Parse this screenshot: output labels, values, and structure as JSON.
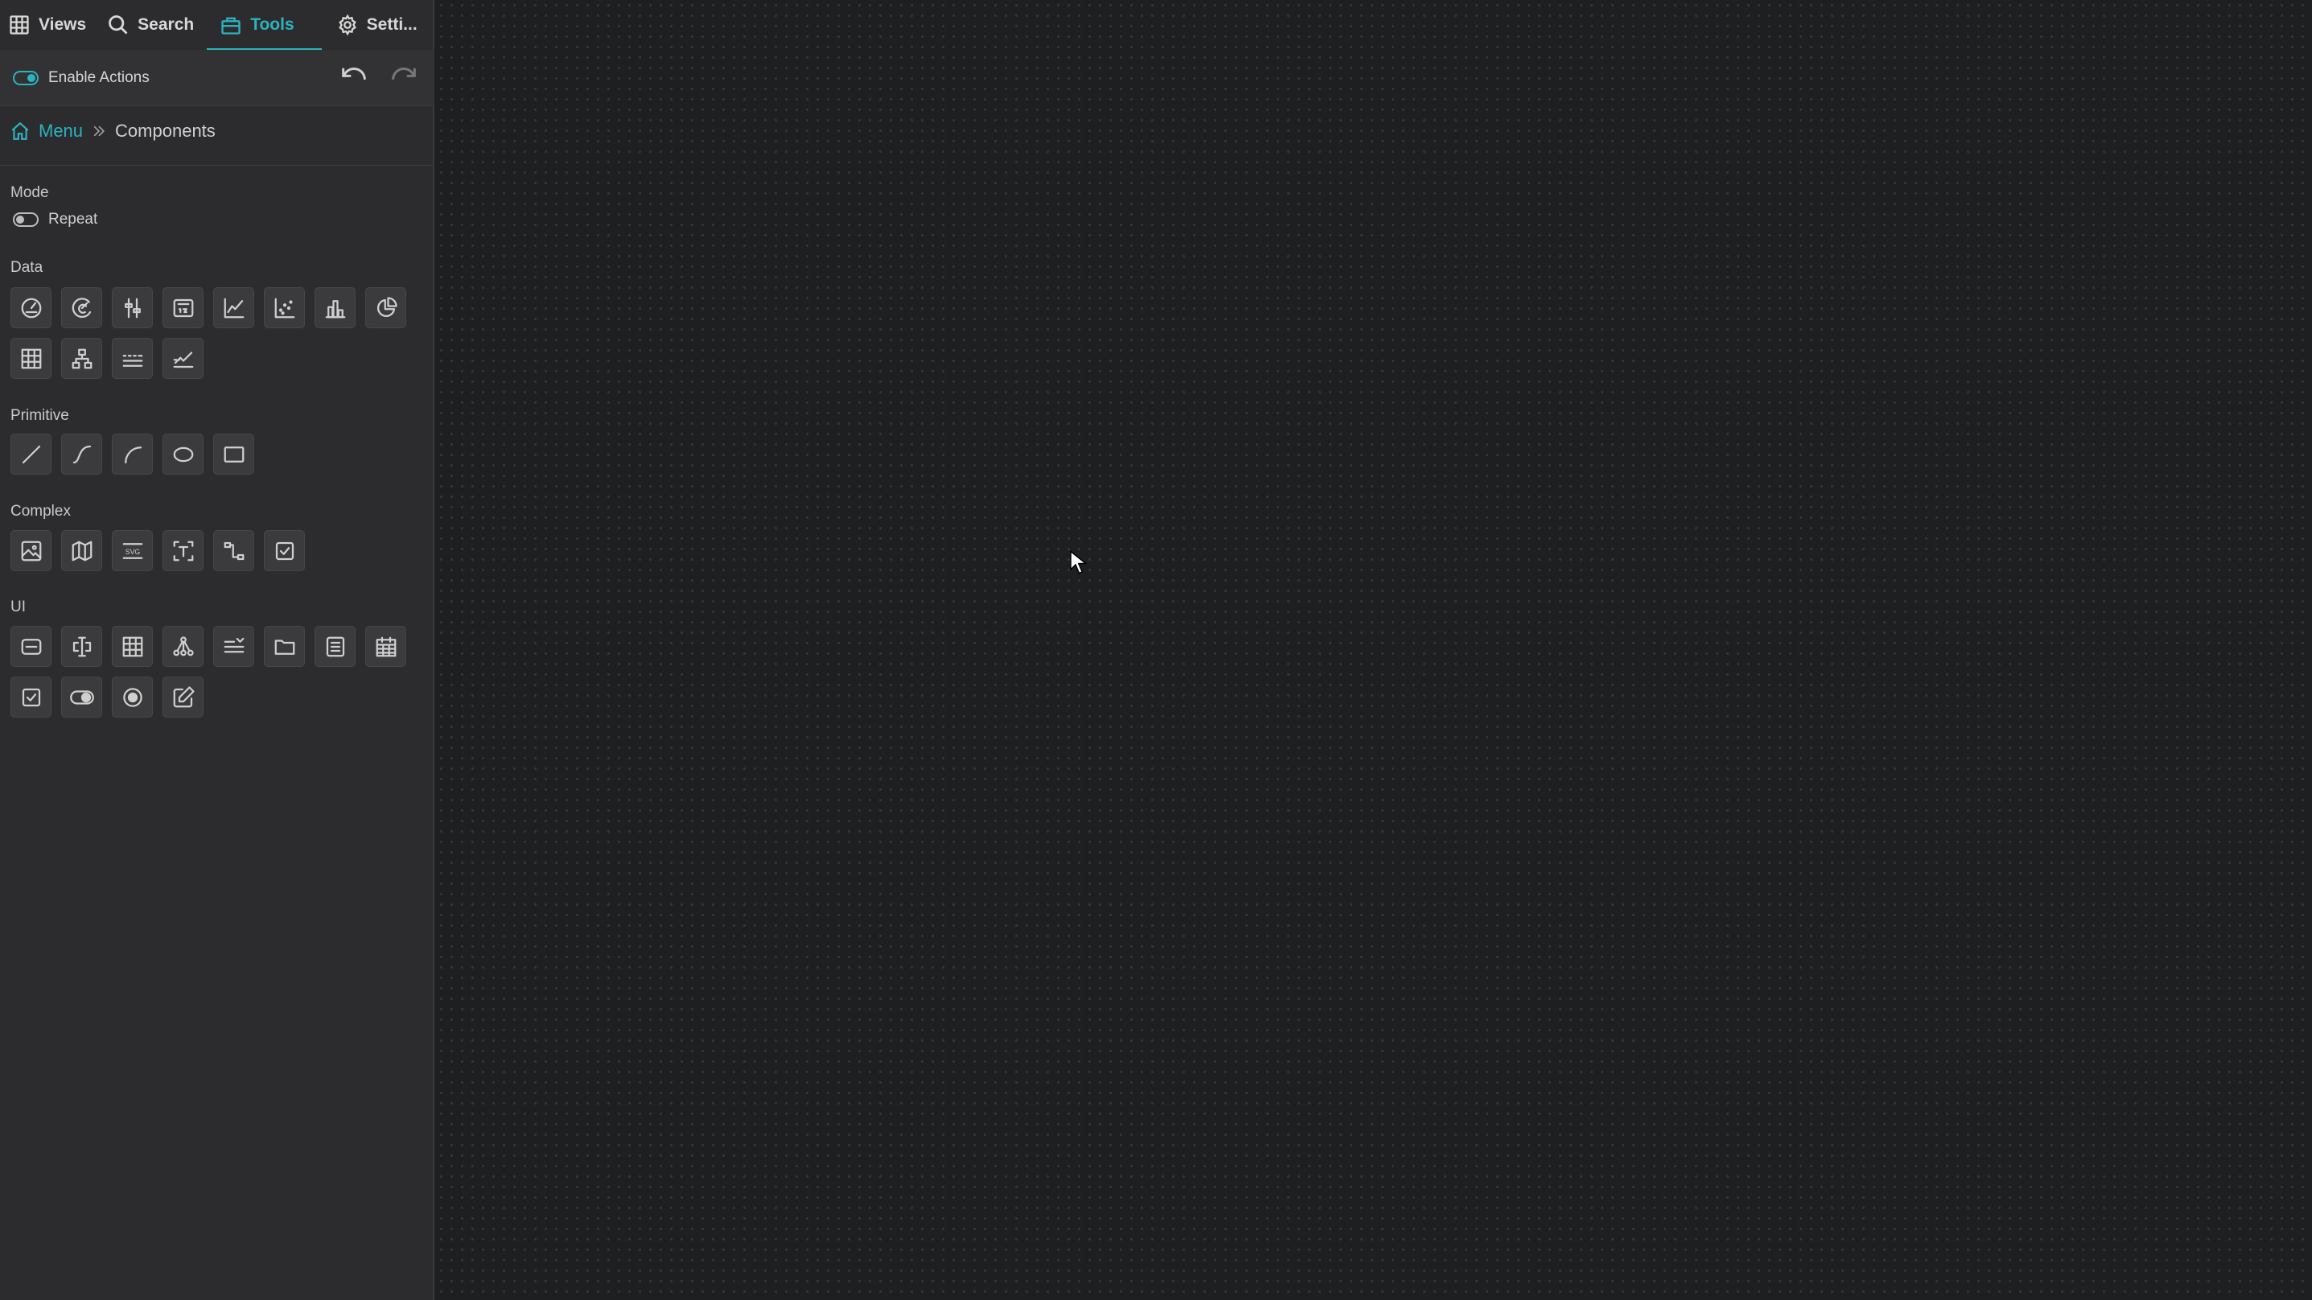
{
  "tabs": [
    {
      "label": "Views",
      "icon": "grid-icon"
    },
    {
      "label": "Search",
      "icon": "search-icon"
    },
    {
      "label": "Tools",
      "icon": "toolbox-icon",
      "active": true
    },
    {
      "label": "Setti...",
      "icon": "gear-icon"
    }
  ],
  "actions": {
    "enable_label": "Enable Actions",
    "enabled": true
  },
  "breadcrumb": {
    "menu": "Menu",
    "current": "Components"
  },
  "sections": {
    "mode": "Mode",
    "mode_option": "Repeat",
    "mode_repeat_on": false,
    "data": "Data",
    "primitive": "Primitive",
    "complex": "Complex",
    "ui": "UI"
  },
  "colors": {
    "accent": "#2bb3c0",
    "sidebar": "#2c2c2e",
    "canvas": "#1e1f21"
  },
  "icons": {
    "data": [
      "gauge-icon",
      "radial-gauge-icon",
      "vertical-slider-icon",
      "numeric-display-icon",
      "line-chart-icon",
      "scatter-chart-icon",
      "bar-chart-icon",
      "pie-chart-icon",
      "heatmap-icon",
      "tree-chart-icon",
      "sparkline-icon",
      "trend-chart-icon"
    ],
    "primitive": [
      "line-icon",
      "curve-icon",
      "arc-icon",
      "ellipse-icon",
      "rectangle-icon"
    ],
    "complex": [
      "image-icon",
      "map-icon",
      "svg-icon",
      "text-icon",
      "pipe-icon",
      "checkbox-icon"
    ],
    "ui": [
      "input-field-icon",
      "text-cursor-icon",
      "table-icon",
      "tree-icon",
      "dropdown-icon",
      "folder-icon",
      "list-icon",
      "calendar-icon",
      "checkbox-icon",
      "toggle-icon",
      "radio-icon",
      "edit-icon"
    ]
  }
}
